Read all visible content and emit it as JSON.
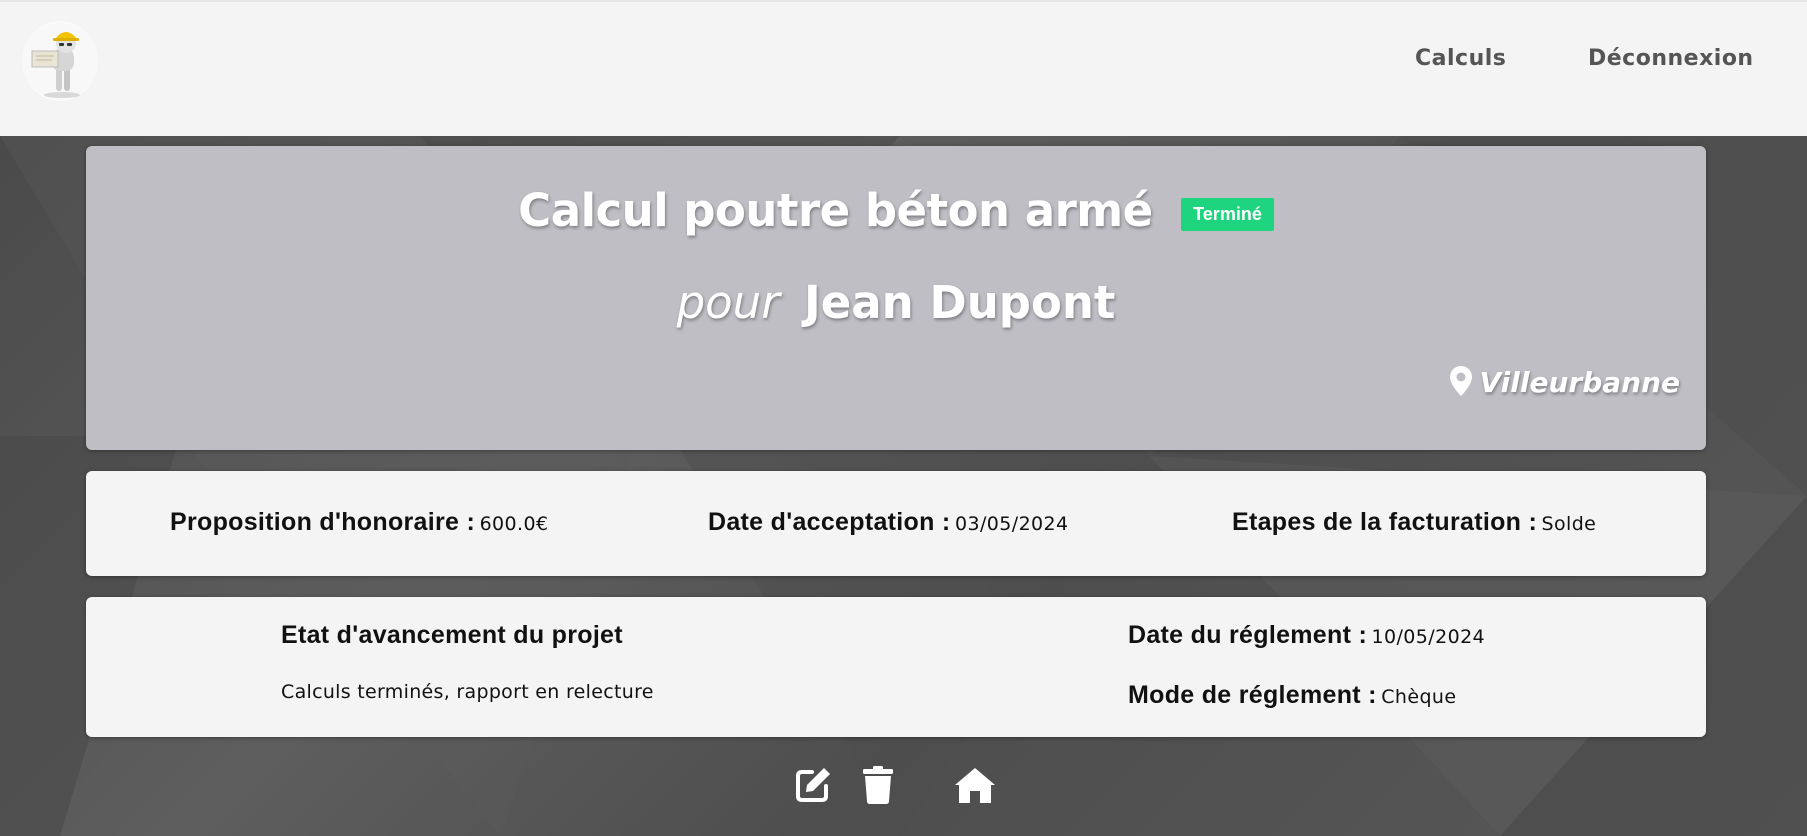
{
  "navbar": {
    "links": {
      "calculs": "Calculs",
      "deconnexion": "Déconnexion"
    },
    "logo_icon": "engineer-mascot-logo"
  },
  "project": {
    "title": "Calcul poutre béton armé",
    "status": "Terminé",
    "status_color": "#1fd47e",
    "client_prefix": "pour",
    "client_name": "Jean Dupont",
    "location_icon": "map-marker-icon",
    "location": "Villeurbanne"
  },
  "info": {
    "honoraire_label": "Proposition d'honoraire :",
    "honoraire_value": "600.0€",
    "acceptation_label": "Date d'acceptation :",
    "acceptation_value": "03/05/2024",
    "etapes_label": "Etapes de la facturation :",
    "etapes_value": "Solde"
  },
  "details": {
    "etat_title": "Etat d'avancement du projet",
    "etat_text": "Calculs terminés, rapport en relecture",
    "reglement_date_label": "Date du réglement :",
    "reglement_date_value": "10/05/2024",
    "reglement_mode_label": "Mode de réglement :",
    "reglement_mode_value": "Chèque"
  },
  "actions": {
    "edit_icon": "edit-icon",
    "delete_icon": "trash-icon",
    "home_icon": "home-icon"
  },
  "colors": {
    "navbar_bg": "#f4f4f4",
    "page_bg": "#505050",
    "header_card_bg": "#bfbec5",
    "card_bg": "#f4f4f4"
  }
}
